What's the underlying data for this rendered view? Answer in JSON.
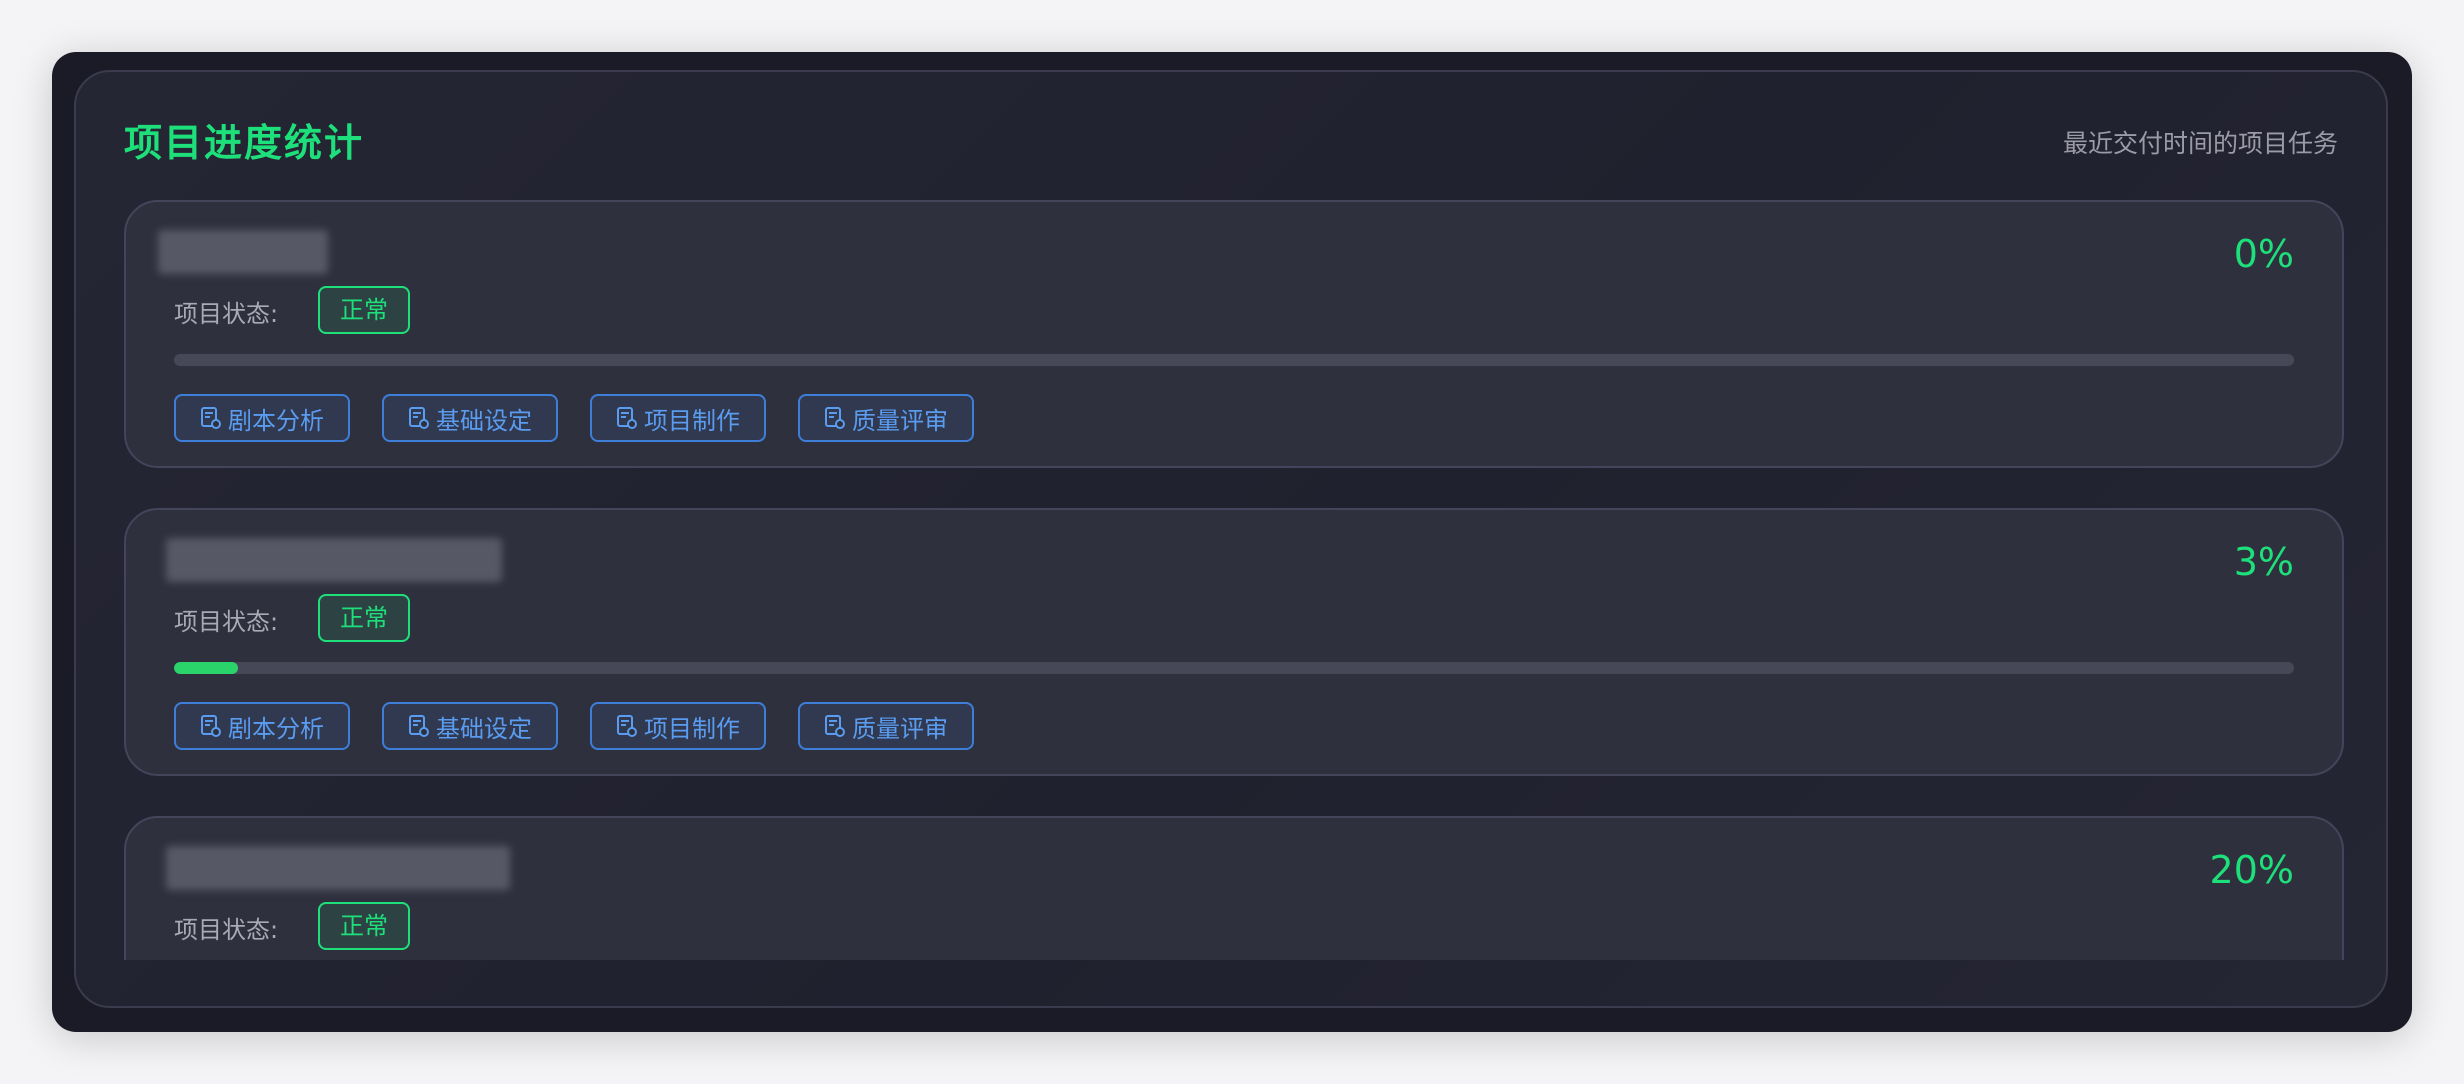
{
  "panel": {
    "title": "项目进度统计",
    "subtitle": "最近交付时间的项目任务"
  },
  "projects": [
    {
      "progress_label": "0%",
      "progress_fraction": 0.0,
      "status_label": "项目状态:",
      "status": "正常"
    },
    {
      "progress_label": "3%",
      "progress_fraction": 0.03,
      "status_label": "项目状态:",
      "status": "正常"
    },
    {
      "progress_label": "20%",
      "progress_fraction": 0.2,
      "status_label": "项目状态:",
      "status": "正常"
    }
  ],
  "actions": [
    {
      "label": "剧本分析",
      "icon": "document-icon"
    },
    {
      "label": "基础设定",
      "icon": "document-icon"
    },
    {
      "label": "项目制作",
      "icon": "document-icon"
    },
    {
      "label": "质量评审",
      "icon": "document-icon"
    }
  ],
  "colors": {
    "accent_green": "#1ee07a",
    "action_blue": "#3f7ed8",
    "card_bg": "#2f303e"
  }
}
